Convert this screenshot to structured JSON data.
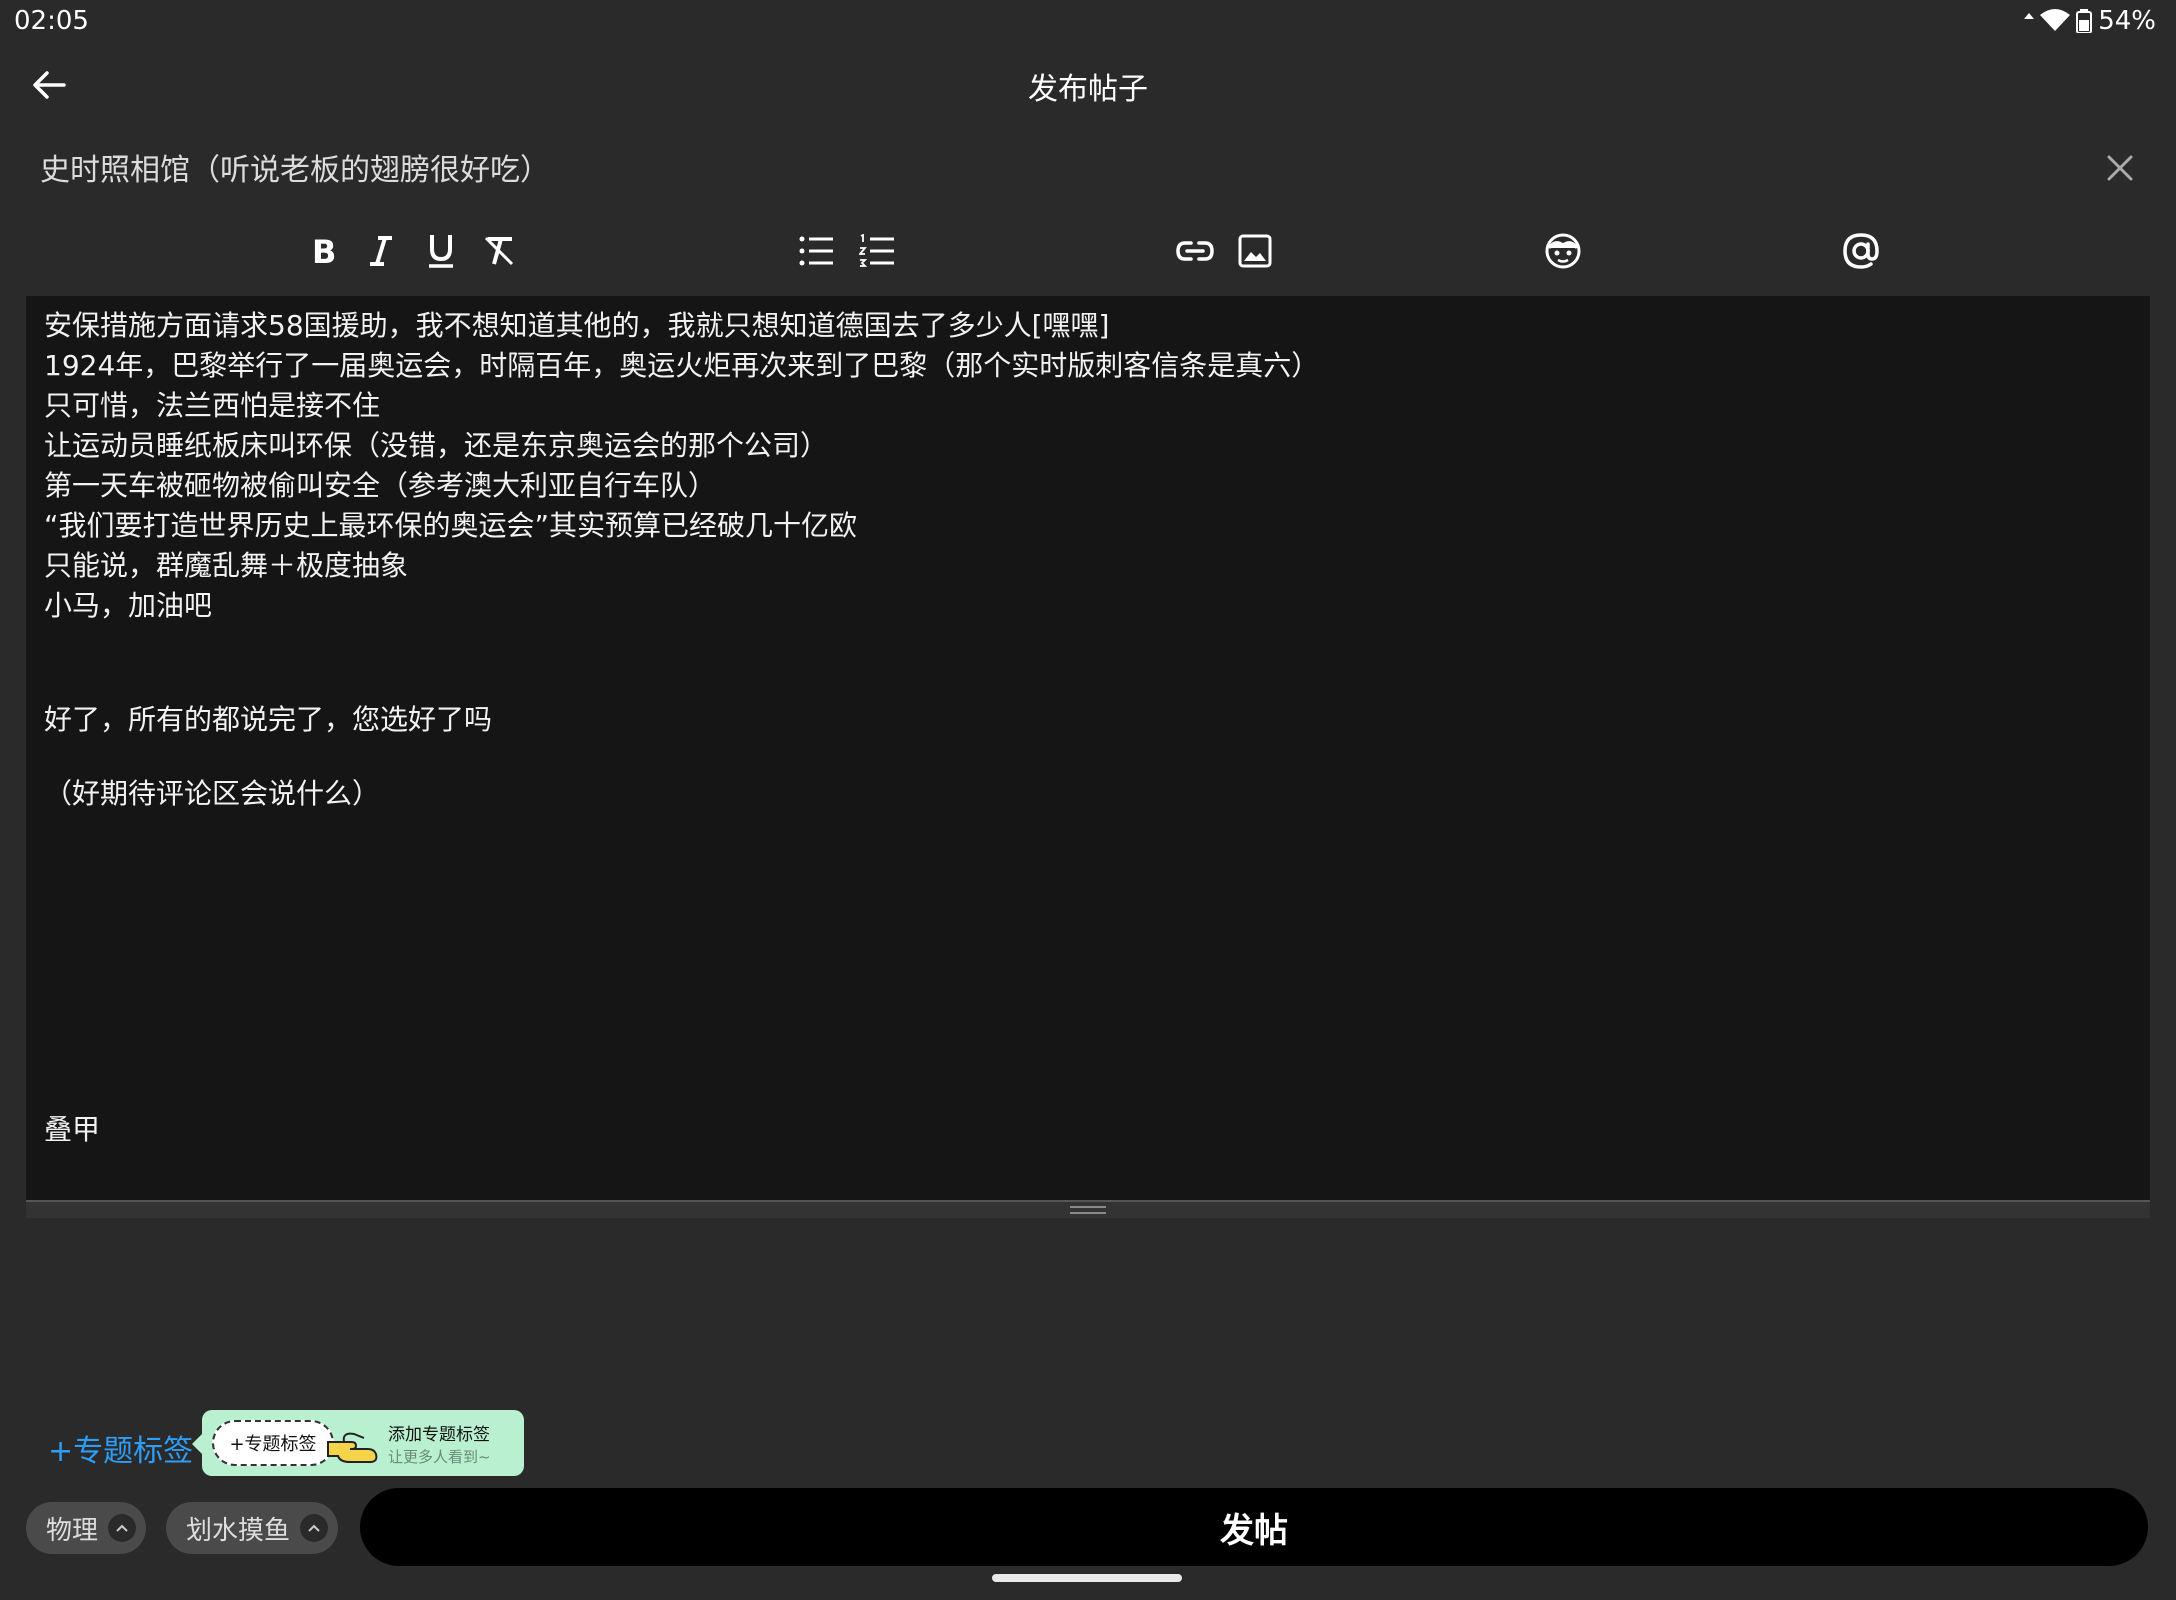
{
  "status_bar": {
    "time": "02:05",
    "battery": "54%",
    "icons": [
      "data-arrows-icon",
      "wifi-icon",
      "battery-icon"
    ]
  },
  "header": {
    "title": "发布帖子",
    "back_icon": "back-arrow-icon"
  },
  "title_field": {
    "value": "史时照相馆（听说老板的翅膀很好吃）",
    "clear_icon": "close-icon"
  },
  "toolbar": {
    "items": [
      "bold-icon",
      "italic-icon",
      "underline-icon",
      "clear-format-icon",
      "bullet-list-icon",
      "numbered-list-icon",
      "link-icon",
      "image-icon",
      "emoji-icon",
      "mention-icon"
    ]
  },
  "editor": {
    "lines": [
      "安保措施方面请求58国援助，我不想知道其他的，我就只想知道德国去了多少人[嘿嘿]",
      "1924年，巴黎举行了一届奥运会，时隔百年，奥运火炬再次来到了巴黎（那个实时版刺客信条是真六）",
      "只可惜，法兰西怕是接不住",
      "让运动员睡纸板床叫环保（没错，还是东京奥运会的那个公司）",
      "第一天车被砸物被偷叫安全（参考澳大利亚自行车队）",
      "“我们要打造世界历史上最环保的奥运会”其实预算已经破几十亿欧",
      "只能说，群魔乱舞＋极度抽象",
      "小马，加油吧"
    ],
    "line_after_1": "好了，所有的都说完了，您选好了吗",
    "line_after_2": "（好期待评论区会说什么）",
    "signature": "叠甲"
  },
  "topic": {
    "link_label": "+专题标签",
    "tip_pill": "+专题标签",
    "tip_title": "添加专题标签",
    "tip_subtitle": "让更多人看到~",
    "tip_color": "#b9f0d0",
    "link_color": "#2e9df5"
  },
  "tags": [
    {
      "label": "物理"
    },
    {
      "label": "划水摸鱼"
    }
  ],
  "publish_button": {
    "label": "发帖"
  }
}
